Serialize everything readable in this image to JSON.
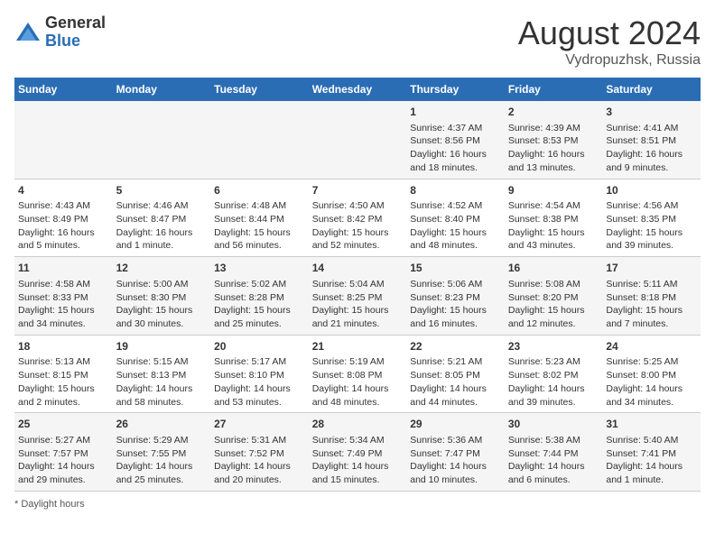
{
  "header": {
    "logo_general": "General",
    "logo_blue": "Blue",
    "main_title": "August 2024",
    "sub_title": "Vydropuzhsk, Russia"
  },
  "days_of_week": [
    "Sunday",
    "Monday",
    "Tuesday",
    "Wednesday",
    "Thursday",
    "Friday",
    "Saturday"
  ],
  "weeks": [
    [
      {
        "day": "",
        "sunrise": "",
        "sunset": "",
        "daylight": ""
      },
      {
        "day": "",
        "sunrise": "",
        "sunset": "",
        "daylight": ""
      },
      {
        "day": "",
        "sunrise": "",
        "sunset": "",
        "daylight": ""
      },
      {
        "day": "",
        "sunrise": "",
        "sunset": "",
        "daylight": ""
      },
      {
        "day": "1",
        "sunrise": "Sunrise: 4:37 AM",
        "sunset": "Sunset: 8:56 PM",
        "daylight": "Daylight: 16 hours and 18 minutes."
      },
      {
        "day": "2",
        "sunrise": "Sunrise: 4:39 AM",
        "sunset": "Sunset: 8:53 PM",
        "daylight": "Daylight: 16 hours and 13 minutes."
      },
      {
        "day": "3",
        "sunrise": "Sunrise: 4:41 AM",
        "sunset": "Sunset: 8:51 PM",
        "daylight": "Daylight: 16 hours and 9 minutes."
      }
    ],
    [
      {
        "day": "4",
        "sunrise": "Sunrise: 4:43 AM",
        "sunset": "Sunset: 8:49 PM",
        "daylight": "Daylight: 16 hours and 5 minutes."
      },
      {
        "day": "5",
        "sunrise": "Sunrise: 4:46 AM",
        "sunset": "Sunset: 8:47 PM",
        "daylight": "Daylight: 16 hours and 1 minute."
      },
      {
        "day": "6",
        "sunrise": "Sunrise: 4:48 AM",
        "sunset": "Sunset: 8:44 PM",
        "daylight": "Daylight: 15 hours and 56 minutes."
      },
      {
        "day": "7",
        "sunrise": "Sunrise: 4:50 AM",
        "sunset": "Sunset: 8:42 PM",
        "daylight": "Daylight: 15 hours and 52 minutes."
      },
      {
        "day": "8",
        "sunrise": "Sunrise: 4:52 AM",
        "sunset": "Sunset: 8:40 PM",
        "daylight": "Daylight: 15 hours and 48 minutes."
      },
      {
        "day": "9",
        "sunrise": "Sunrise: 4:54 AM",
        "sunset": "Sunset: 8:38 PM",
        "daylight": "Daylight: 15 hours and 43 minutes."
      },
      {
        "day": "10",
        "sunrise": "Sunrise: 4:56 AM",
        "sunset": "Sunset: 8:35 PM",
        "daylight": "Daylight: 15 hours and 39 minutes."
      }
    ],
    [
      {
        "day": "11",
        "sunrise": "Sunrise: 4:58 AM",
        "sunset": "Sunset: 8:33 PM",
        "daylight": "Daylight: 15 hours and 34 minutes."
      },
      {
        "day": "12",
        "sunrise": "Sunrise: 5:00 AM",
        "sunset": "Sunset: 8:30 PM",
        "daylight": "Daylight: 15 hours and 30 minutes."
      },
      {
        "day": "13",
        "sunrise": "Sunrise: 5:02 AM",
        "sunset": "Sunset: 8:28 PM",
        "daylight": "Daylight: 15 hours and 25 minutes."
      },
      {
        "day": "14",
        "sunrise": "Sunrise: 5:04 AM",
        "sunset": "Sunset: 8:25 PM",
        "daylight": "Daylight: 15 hours and 21 minutes."
      },
      {
        "day": "15",
        "sunrise": "Sunrise: 5:06 AM",
        "sunset": "Sunset: 8:23 PM",
        "daylight": "Daylight: 15 hours and 16 minutes."
      },
      {
        "day": "16",
        "sunrise": "Sunrise: 5:08 AM",
        "sunset": "Sunset: 8:20 PM",
        "daylight": "Daylight: 15 hours and 12 minutes."
      },
      {
        "day": "17",
        "sunrise": "Sunrise: 5:11 AM",
        "sunset": "Sunset: 8:18 PM",
        "daylight": "Daylight: 15 hours and 7 minutes."
      }
    ],
    [
      {
        "day": "18",
        "sunrise": "Sunrise: 5:13 AM",
        "sunset": "Sunset: 8:15 PM",
        "daylight": "Daylight: 15 hours and 2 minutes."
      },
      {
        "day": "19",
        "sunrise": "Sunrise: 5:15 AM",
        "sunset": "Sunset: 8:13 PM",
        "daylight": "Daylight: 14 hours and 58 minutes."
      },
      {
        "day": "20",
        "sunrise": "Sunrise: 5:17 AM",
        "sunset": "Sunset: 8:10 PM",
        "daylight": "Daylight: 14 hours and 53 minutes."
      },
      {
        "day": "21",
        "sunrise": "Sunrise: 5:19 AM",
        "sunset": "Sunset: 8:08 PM",
        "daylight": "Daylight: 14 hours and 48 minutes."
      },
      {
        "day": "22",
        "sunrise": "Sunrise: 5:21 AM",
        "sunset": "Sunset: 8:05 PM",
        "daylight": "Daylight: 14 hours and 44 minutes."
      },
      {
        "day": "23",
        "sunrise": "Sunrise: 5:23 AM",
        "sunset": "Sunset: 8:02 PM",
        "daylight": "Daylight: 14 hours and 39 minutes."
      },
      {
        "day": "24",
        "sunrise": "Sunrise: 5:25 AM",
        "sunset": "Sunset: 8:00 PM",
        "daylight": "Daylight: 14 hours and 34 minutes."
      }
    ],
    [
      {
        "day": "25",
        "sunrise": "Sunrise: 5:27 AM",
        "sunset": "Sunset: 7:57 PM",
        "daylight": "Daylight: 14 hours and 29 minutes."
      },
      {
        "day": "26",
        "sunrise": "Sunrise: 5:29 AM",
        "sunset": "Sunset: 7:55 PM",
        "daylight": "Daylight: 14 hours and 25 minutes."
      },
      {
        "day": "27",
        "sunrise": "Sunrise: 5:31 AM",
        "sunset": "Sunset: 7:52 PM",
        "daylight": "Daylight: 14 hours and 20 minutes."
      },
      {
        "day": "28",
        "sunrise": "Sunrise: 5:34 AM",
        "sunset": "Sunset: 7:49 PM",
        "daylight": "Daylight: 14 hours and 15 minutes."
      },
      {
        "day": "29",
        "sunrise": "Sunrise: 5:36 AM",
        "sunset": "Sunset: 7:47 PM",
        "daylight": "Daylight: 14 hours and 10 minutes."
      },
      {
        "day": "30",
        "sunrise": "Sunrise: 5:38 AM",
        "sunset": "Sunset: 7:44 PM",
        "daylight": "Daylight: 14 hours and 6 minutes."
      },
      {
        "day": "31",
        "sunrise": "Sunrise: 5:40 AM",
        "sunset": "Sunset: 7:41 PM",
        "daylight": "Daylight: 14 hours and 1 minute."
      }
    ]
  ],
  "footer": {
    "note": "Daylight hours"
  }
}
